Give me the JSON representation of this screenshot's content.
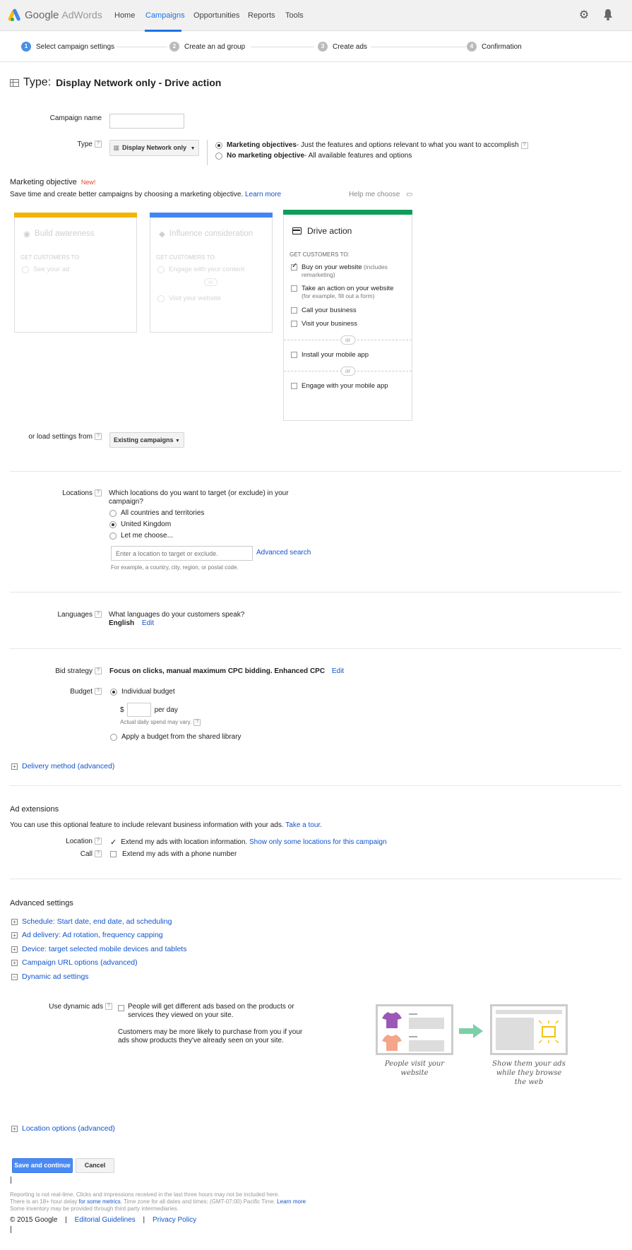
{
  "app": {
    "logo_google": "Google",
    "logo_adwords": "AdWords"
  },
  "nav": {
    "home": "Home",
    "campaigns": "Campaigns",
    "opportunities": "Opportunities",
    "reports": "Reports",
    "tools": "Tools"
  },
  "steps": [
    {
      "num": "1",
      "label": "Select campaign settings"
    },
    {
      "num": "2",
      "label": "Create an ad group"
    },
    {
      "num": "3",
      "label": "Create ads"
    },
    {
      "num": "4",
      "label": "Confirmation"
    }
  ],
  "title": {
    "prefix": "Type:",
    "value": "Display Network only - Drive action"
  },
  "campaign_name": {
    "label": "Campaign name",
    "value": ""
  },
  "type": {
    "label": "Type",
    "dropdown": "Display Network only",
    "opt1_bold": "Marketing objectives",
    "opt1_desc": " - Just the features and options relevant to what you want to accomplish",
    "opt2_bold": "No marketing objective",
    "opt2_desc": " - All available features and options"
  },
  "objective": {
    "heading": "Marketing objective",
    "new_badge": "New!",
    "desc": "Save time and create better campaigns by choosing a marketing objective.",
    "learn_more": "Learn more",
    "help_me": "Help me choose",
    "cards": [
      {
        "title": "Build awareness",
        "get": "GET CUSTOMERS TO:",
        "opts": [
          "See your ad"
        ],
        "color": "#f4b400"
      },
      {
        "title": "Influence consideration",
        "get": "GET CUSTOMERS TO:",
        "opts": [
          "Engage with your content",
          "Visit your website"
        ],
        "or": "or",
        "color": "#4285f4"
      },
      {
        "title": "Drive action",
        "get": "GET CUSTOMERS TO:",
        "color": "#0f9d58",
        "opt1": "Buy on your website",
        "opt1_note": " (includes remarketing)",
        "opt2": "Take an action on your website",
        "opt2_note": "(for example, fill out a form)",
        "opt3": "Call your business",
        "opt4": "Visit your business",
        "opt5": "Install your mobile app",
        "opt6": "Engage with your mobile app",
        "or": "or"
      }
    ]
  },
  "load_settings": {
    "label": "or load settings from",
    "button": "Existing campaigns"
  },
  "locations": {
    "label": "Locations",
    "question": "Which locations do you want to target (or exclude) in your campaign?",
    "opt1": "All countries and territories",
    "opt2": "United Kingdom",
    "opt3": "Let me choose...",
    "placeholder": "Enter a location to target or exclude.",
    "advanced": "Advanced search",
    "hint": "For example, a country, city, region, or postal code."
  },
  "languages": {
    "label": "Languages",
    "question": "What languages do your customers speak?",
    "value": "English",
    "edit": "Edit"
  },
  "bid": {
    "label": "Bid strategy",
    "value": "Focus on clicks, manual maximum CPC bidding. Enhanced CPC",
    "edit": "Edit"
  },
  "budget": {
    "label": "Budget",
    "opt1": "Individual budget",
    "currency": "$",
    "per_day": "per day",
    "note": "Actual daily spend may vary.",
    "opt2": "Apply a budget from the shared library"
  },
  "delivery": "Delivery method (advanced)",
  "extensions": {
    "heading": "Ad extensions",
    "desc": "You can use this optional feature to include relevant business information with your ads.",
    "tour": "Take a tour.",
    "location_label": "Location",
    "location_text": "Extend my ads with location information.",
    "location_link": "Show only some locations for this campaign",
    "call_label": "Call",
    "call_text": "Extend my ads with a phone number"
  },
  "advanced": {
    "heading": "Advanced settings",
    "items": [
      "Schedule: Start date, end date, ad scheduling",
      "Ad delivery: Ad rotation, frequency capping",
      "Device: target selected mobile devices and tablets",
      "Campaign URL options (advanced)",
      "Dynamic ad settings"
    ]
  },
  "dynamic": {
    "label": "Use dynamic ads",
    "text1": "People will get different ads based on the products or services they viewed on your site.",
    "text2": "Customers may be more likely to purchase from you if your ads show products they've already seen on your site.",
    "caption1": "People visit your website",
    "caption2": "Show them your ads while they browse the web"
  },
  "location_options": "Location options (advanced)",
  "buttons": {
    "save": "Save and continue",
    "cancel": "Cancel"
  },
  "footer": {
    "line1": "Reporting is not real-time. Clicks and impressions received in the last three hours may not be included here.",
    "line2a": "There is an 18+ hour delay ",
    "line2b": "for some metrics",
    "line2c": ". Time zone for all dates and times: (GMT-07:00) Pacific Time. ",
    "line2d": "Learn more",
    "line3": "Some inventory may be provided through third party intermediaries.",
    "copyright": "© 2015 Google",
    "editorial": "Editorial Guidelines",
    "privacy": "Privacy Policy",
    "sep": "|"
  }
}
